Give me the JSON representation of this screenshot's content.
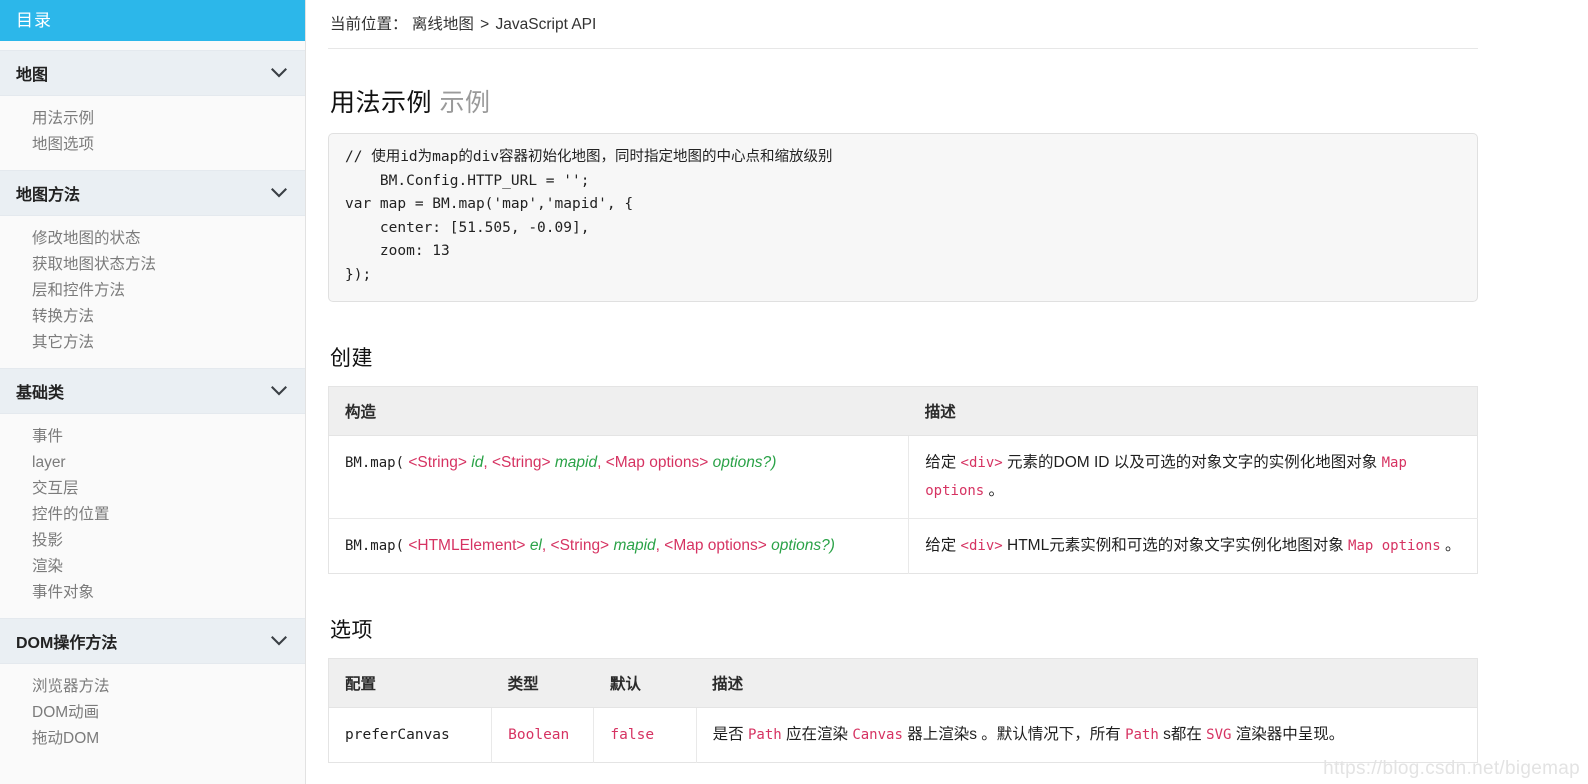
{
  "sidebar": {
    "title": "目录",
    "chevron_icon": "chevron-down-icon",
    "sections": [
      {
        "label": "地图",
        "items": [
          "用法示例",
          "地图选项"
        ]
      },
      {
        "label": "地图方法",
        "items": [
          "修改地图的状态",
          "获取地图状态方法",
          "层和控件方法",
          "转换方法",
          "其它方法"
        ]
      },
      {
        "label": "基础类",
        "items": [
          "事件",
          "layer",
          "交互层",
          "控件的位置",
          "投影",
          "渲染",
          "事件对象"
        ]
      },
      {
        "label": "DOM操作方法",
        "items": [
          "浏览器方法",
          "DOM动画",
          "拖动DOM"
        ]
      }
    ]
  },
  "breadcrumb": {
    "label": "当前位置：",
    "crumbs": [
      "离线地图",
      "JavaScript API"
    ],
    "separator": ">"
  },
  "usage": {
    "heading": "用法示例",
    "heading_muted": "示例",
    "code": "// 使用id为map的div容器初始化地图，同时指定地图的中心点和缩放级别\n    BM.Config.HTTP_URL = '';\nvar map = BM.map('map','mapid', {\n    center: [51.505, -0.09],\n    zoom: 13\n});"
  },
  "create": {
    "heading": "创建",
    "columns": [
      "构造",
      "描述"
    ],
    "rows": [
      {
        "signature": {
          "name": "BM.map(",
          "parts": [
            {
              "type": "<String>",
              "param": "id"
            },
            {
              "type": "<String>",
              "param": "mapid"
            },
            {
              "type": "<Map options>",
              "param": "options?"
            }
          ],
          "close": ")"
        },
        "description": {
          "pre": "给定 ",
          "code1": "<div>",
          "mid": " 元素的DOM ID 以及可选的对象文字的实例化地图对象 ",
          "code2": "Map options",
          "post": " 。"
        }
      },
      {
        "signature": {
          "name": "BM.map(",
          "parts": [
            {
              "type": "<HTMLElement>",
              "param": "el"
            },
            {
              "type": "<String>",
              "param": "mapid"
            },
            {
              "type": "<Map options>",
              "param": "options?"
            }
          ],
          "close": ")"
        },
        "description": {
          "pre": "给定 ",
          "code1": "<div>",
          "mid": " HTML元素实例和可选的对象文字实例化地图对象 ",
          "code2": "Map options",
          "post": " 。"
        }
      }
    ]
  },
  "options": {
    "heading": "选项",
    "columns": [
      "配置",
      "类型",
      "默认",
      "描述"
    ],
    "rows": [
      {
        "name": "preferCanvas",
        "type": "Boolean",
        "default": "false",
        "description": {
          "t1": "是否 ",
          "c1": "Path",
          "t2": " 应在渲染 ",
          "c2": "Canvas",
          "t3": " 器上渲染s 。默认情况下，所有 ",
          "c3": "Path",
          "t4": " s都在 ",
          "c4": "SVG",
          "t5": " 渲染器中呈现。"
        }
      }
    ]
  },
  "watermark": "https://blog.csdn.net/bigemap",
  "colors": {
    "sidebar_header_bg": "#2cb7ea",
    "section_header_bg": "#eaeff3",
    "code_text": "#d63362",
    "param_green": "#2aa247"
  }
}
